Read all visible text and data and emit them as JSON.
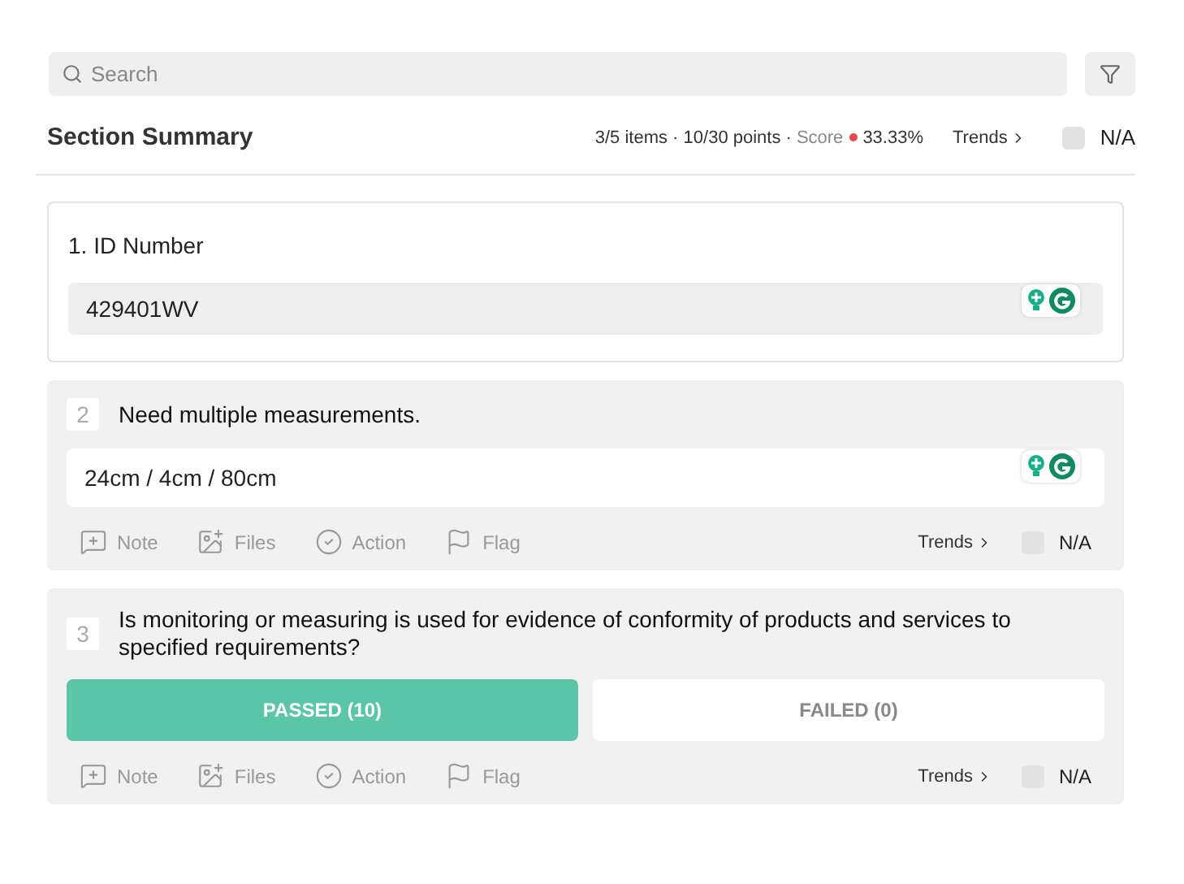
{
  "search": {
    "placeholder": "Search"
  },
  "summary": {
    "title": "Section Summary",
    "stats": "3/5 items · 10/30 points ·",
    "score_label": "Score",
    "score_dot": {
      "color": "#e5484d"
    },
    "score": "33.33%",
    "trends": "Trends",
    "na": {
      "label": "N/A",
      "checked": false
    }
  },
  "questions": [
    {
      "kind": "heading",
      "title": "1. ID Number",
      "value": "429401WV"
    },
    {
      "kind": "field",
      "number": "2",
      "prompt": "Need multiple measurements.",
      "value": "24cm / 4cm / 80cm",
      "actions": [
        {
          "kind": "note",
          "label": "Note"
        },
        {
          "kind": "files",
          "label": "Files"
        },
        {
          "kind": "action",
          "label": "Action"
        },
        {
          "kind": "flag",
          "label": "Flag"
        }
      ],
      "trends": "Trends",
      "na": {
        "label": "N/A",
        "checked": false
      }
    },
    {
      "kind": "choice",
      "number": "3",
      "prompt": "Is monitoring or measuring is used for evidence of conformity of products and services to specified requirements?",
      "options": [
        {
          "label": "PASSED (10)",
          "selected": true
        },
        {
          "label": "FAILED (0)",
          "selected": false
        }
      ],
      "actions": [
        {
          "kind": "note",
          "label": "Note"
        },
        {
          "kind": "files",
          "label": "Files"
        },
        {
          "kind": "action",
          "label": "Action"
        },
        {
          "kind": "flag",
          "label": "Flag"
        }
      ],
      "trends": "Trends",
      "na": {
        "label": "N/A",
        "checked": false
      }
    }
  ]
}
